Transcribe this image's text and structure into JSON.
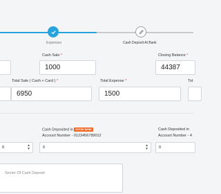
{
  "steps": {
    "expenses_label": "Expenses",
    "bank_label": "Cash Deposit At Bank",
    "accent": "#29a3dd"
  },
  "fields": {
    "cash_sale": {
      "label": "Cash Sale",
      "value": "1000"
    },
    "closing_balance": {
      "label": "Closing Balance",
      "value": "44387"
    },
    "total_sale": {
      "label": "Total Sale ( Cash + Card )",
      "value": "6950"
    },
    "total_expense": {
      "label": "Total Expense",
      "value": "1500"
    },
    "total_cut": {
      "label": "Tot"
    }
  },
  "deposit": {
    "label": "Cash Deposited in",
    "bank": "KOTAK BANK",
    "account_1": "Account Number - 0123456789012",
    "account_2_label": "Cash Deposited in",
    "account_2": "Account Number - 4",
    "value_1": "0",
    "value_2": "0",
    "value_0": "0"
  },
  "sector": {
    "placeholder": "Sector Of Cash Deposit"
  }
}
